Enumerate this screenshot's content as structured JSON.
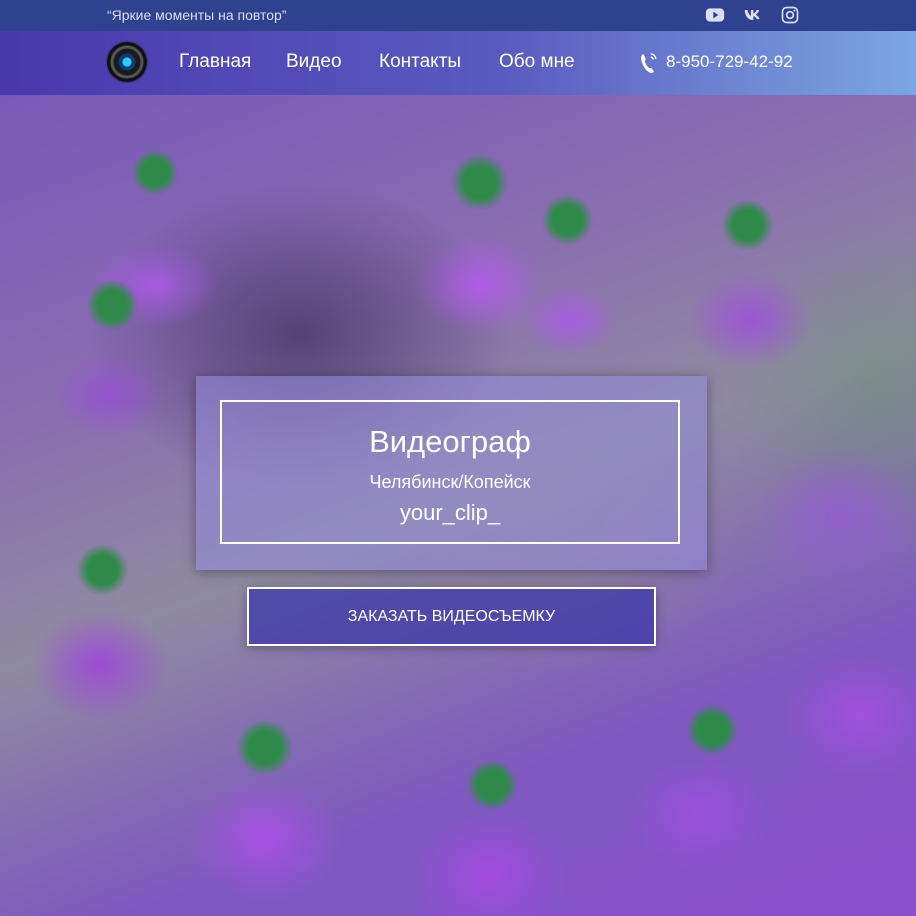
{
  "topbar": {
    "tagline": "“Яркие моменты на повтор”",
    "social": [
      {
        "icon": "youtube-icon"
      },
      {
        "icon": "vk-icon"
      },
      {
        "icon": "instagram-icon"
      }
    ]
  },
  "nav": {
    "logo_icon": "camera-lens-icon",
    "items": [
      {
        "label": "Главная"
      },
      {
        "label": "Видео"
      },
      {
        "label": "Контакты"
      },
      {
        "label": "Обо мне"
      }
    ],
    "phone_icon": "phone-icon",
    "phone": "8-950-729-42-92"
  },
  "hero": {
    "title": "Видеограф",
    "subtitle": "Челябинск/Копейск",
    "handle": "your_clip_",
    "cta_label": "ЗАКАЗАТЬ ВИДЕОСЪЕМКУ"
  },
  "colors": {
    "topbar_bg": "#2e4290",
    "nav_gradient_start": "#4a38ad",
    "nav_gradient_end": "#7ba6e2",
    "text": "#ffffff"
  }
}
